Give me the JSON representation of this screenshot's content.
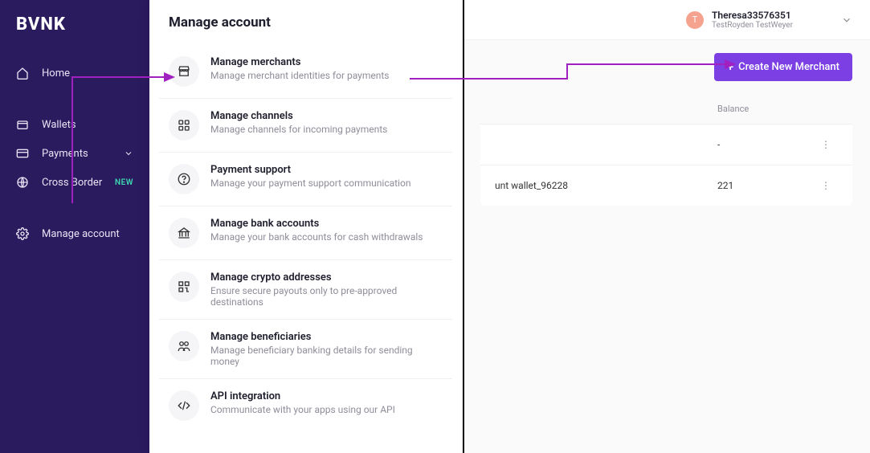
{
  "logo": "BVNK",
  "sidebar": {
    "items": [
      {
        "label": "Home"
      },
      {
        "label": "Wallets"
      },
      {
        "label": "Payments"
      },
      {
        "label": "Cross Border",
        "badge": "NEW"
      },
      {
        "label": "Manage account"
      }
    ]
  },
  "panel": {
    "title": "Manage account",
    "items": [
      {
        "title": "Manage merchants",
        "desc": "Manage merchant identities for payments"
      },
      {
        "title": "Manage channels",
        "desc": "Manage channels for incoming payments"
      },
      {
        "title": "Payment support",
        "desc": "Manage your payment support communication"
      },
      {
        "title": "Manage bank accounts",
        "desc": "Manage your bank accounts for cash withdrawals"
      },
      {
        "title": "Manage crypto addresses",
        "desc": "Ensure secure payouts only to pre-approved destinations"
      },
      {
        "title": "Manage beneficiaries",
        "desc": "Manage beneficiary banking details for sending money"
      },
      {
        "title": "API integration",
        "desc": "Communicate with your apps using our API"
      }
    ]
  },
  "user": {
    "initial": "T",
    "name": "Theresa33576351",
    "sub": "TestRoyden TestWeyer"
  },
  "actions": {
    "create_merchant": "Create New Merchant"
  },
  "table": {
    "headers": {
      "balance": "Balance"
    },
    "rows": [
      {
        "name": "",
        "balance": "-"
      },
      {
        "name": "unt wallet_96228",
        "balance": "221"
      }
    ]
  }
}
